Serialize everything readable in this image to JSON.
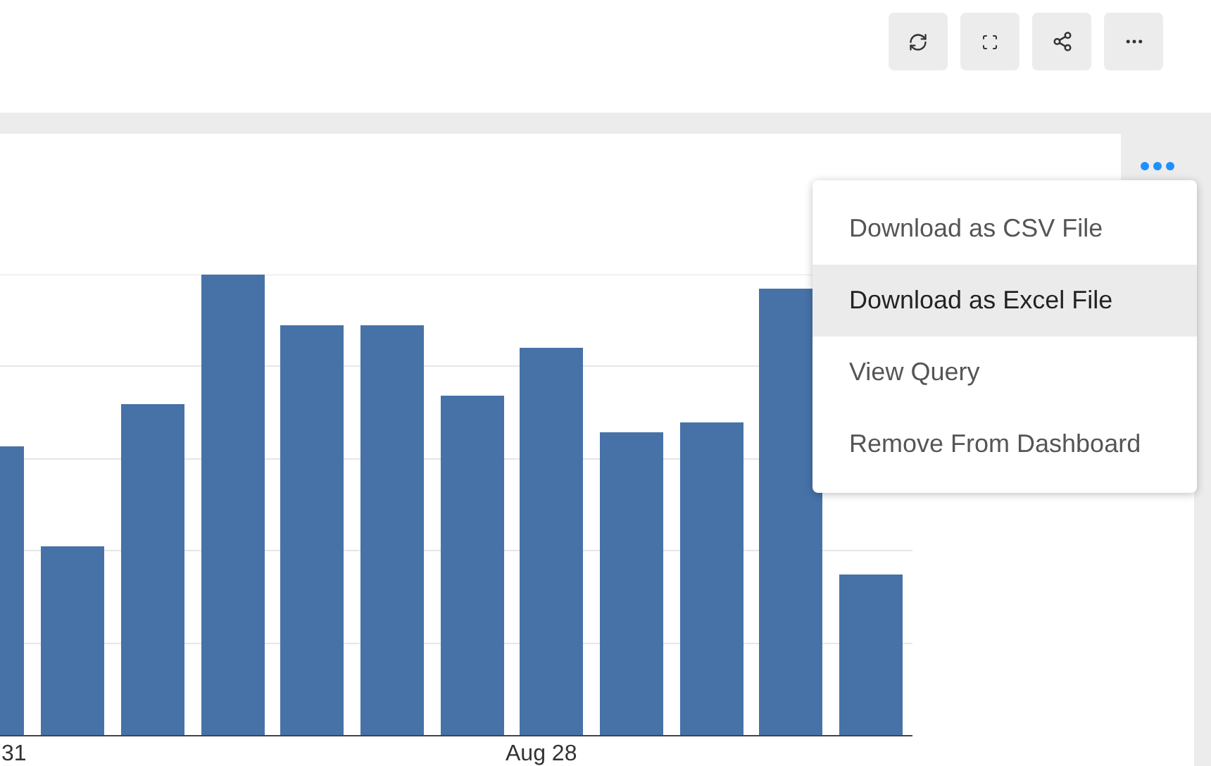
{
  "chart": {
    "x_labels": [
      "31",
      "Aug 28"
    ]
  },
  "menu": {
    "open": true,
    "items": [
      {
        "label": "Download as CSV File",
        "selected": false
      },
      {
        "label": "Download as Excel File",
        "selected": true
      },
      {
        "label": "View Query",
        "selected": false
      },
      {
        "label": "Remove From Dashboard",
        "selected": false
      }
    ]
  }
}
